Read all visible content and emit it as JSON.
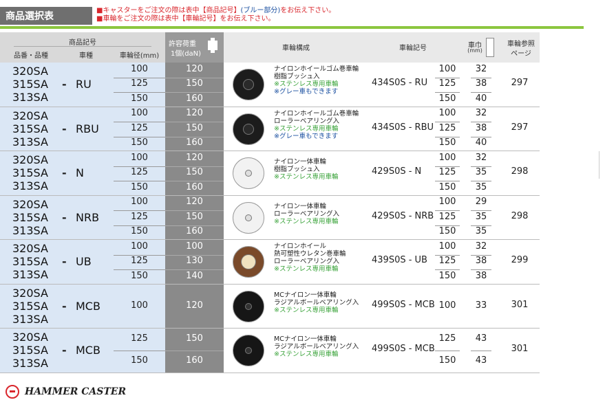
{
  "title": "商品選択表",
  "notes": [
    {
      "pre": "■キャスターをご注文の際は表中【商品記号】",
      "hl": "(ブルー部分)",
      "post": "をお伝え下さい。"
    },
    {
      "pre": "■車輪をご注文の際は表中【車輪記号】をお伝え下さい。",
      "hl": "",
      "post": ""
    }
  ],
  "header": {
    "product_code": "商品記号",
    "part_no": "品番・品種",
    "wheel_type": "車種",
    "wheel_dia": "車輪径(mm)",
    "load_title": "許容荷重",
    "load_unit": "1個(daN)",
    "wheel_config": "車輪構成",
    "wheel_code": "車輪記号",
    "width_title": "車巾",
    "width_unit": "(mm)",
    "ref_page": "車輪参照",
    "ref_page2": "ページ"
  },
  "rows": [
    {
      "models": [
        "320SA",
        "315SA",
        "313SA"
      ],
      "type": "RU",
      "dias": [
        "100",
        "125",
        "150"
      ],
      "loads": [
        "120",
        "150",
        "160"
      ],
      "desc": [
        "ナイロンホイールゴム巻車輪",
        "樹脂ブッシュ入"
      ],
      "green": [
        "※ステンレス専用車輪"
      ],
      "blue": [
        "※グレー車もできます"
      ],
      "wcode": "434S0S - RU",
      "wdias": [
        "100",
        "125",
        "150"
      ],
      "widths": [
        "32",
        "38",
        "40"
      ],
      "page": "297",
      "wheel": "black"
    },
    {
      "models": [
        "320SA",
        "315SA",
        "313SA"
      ],
      "type": "RBU",
      "dias": [
        "100",
        "125",
        "150"
      ],
      "loads": [
        "120",
        "150",
        "160"
      ],
      "desc": [
        "ナイロンホイールゴム巻車輪",
        "ローラーベアリング入"
      ],
      "green": [
        "※ステンレス専用車輪"
      ],
      "blue": [
        "※グレー車もできます"
      ],
      "wcode": "434S0S - RBU",
      "wdias": [
        "100",
        "125",
        "150"
      ],
      "widths": [
        "32",
        "38",
        "40"
      ],
      "page": "297",
      "wheel": "black"
    },
    {
      "models": [
        "320SA",
        "315SA",
        "313SA"
      ],
      "type": "N",
      "dias": [
        "100",
        "125",
        "150"
      ],
      "loads": [
        "120",
        "150",
        "160"
      ],
      "desc": [
        "ナイロン一体車輪",
        "樹脂ブッシュ入"
      ],
      "green": [
        "※ステンレス専用車輪"
      ],
      "blue": [],
      "wcode": "429S0S - N",
      "wdias": [
        "100",
        "125",
        "150"
      ],
      "widths": [
        "32",
        "35",
        "35"
      ],
      "page": "298",
      "wheel": "white"
    },
    {
      "models": [
        "320SA",
        "315SA",
        "313SA"
      ],
      "type": "NRB",
      "dias": [
        "100",
        "125",
        "150"
      ],
      "loads": [
        "120",
        "150",
        "160"
      ],
      "desc": [
        "ナイロン一体車輪",
        "ローラーベアリング入"
      ],
      "green": [
        "※ステンレス専用車輪"
      ],
      "blue": [],
      "wcode": "429S0S - NRB",
      "wdias": [
        "100",
        "125",
        "150"
      ],
      "widths": [
        "29",
        "35",
        "35"
      ],
      "page": "298",
      "wheel": "white"
    },
    {
      "models": [
        "320SA",
        "315SA",
        "313SA"
      ],
      "type": "UB",
      "dias": [
        "100",
        "125",
        "150"
      ],
      "loads": [
        "100",
        "130",
        "140"
      ],
      "desc": [
        "ナイロンホイール",
        "熱可塑性ウレタン巻車輪",
        "ローラーベアリング入"
      ],
      "green": [
        "※ステンレス専用車輪"
      ],
      "blue": [],
      "wcode": "439S0S - UB",
      "wdias": [
        "100",
        "125",
        "150"
      ],
      "widths": [
        "32",
        "38",
        "38"
      ],
      "page": "299",
      "wheel": "brown"
    },
    {
      "models": [
        "320SA",
        "315SA",
        "313SA"
      ],
      "type": "MCB",
      "dias": [
        "100"
      ],
      "loads": [
        "120"
      ],
      "desc": [
        "MCナイロン一体車輪",
        "ラジアルボールベアリング入"
      ],
      "green": [
        "※ステンレス専用車輪"
      ],
      "blue": [],
      "wcode": "499S0S - MCB",
      "wdias": [
        "100"
      ],
      "widths": [
        "33"
      ],
      "page": "301",
      "wheel": "dark"
    },
    {
      "models": [
        "320SA",
        "315SA",
        "313SA"
      ],
      "type": "MCB",
      "dias": [
        "125",
        "150"
      ],
      "loads": [
        "150",
        "160"
      ],
      "desc": [
        "MCナイロン一体車輪",
        "ラジアルボールベアリング入"
      ],
      "green": [
        "※ステンレス専用車輪"
      ],
      "blue": [],
      "wcode": "499S0S - MCB",
      "wdias": [
        "125",
        "150"
      ],
      "widths": [
        "43",
        "43"
      ],
      "page": "301",
      "wheel": "dark"
    }
  ],
  "logo": "HAMMER CASTER",
  "colors": {
    "blue_col": "#dbe7f5",
    "gray_col": "#8a8a8a",
    "green_note": "#3aa33a",
    "red_note": "#d9262c",
    "accent_line": "#8cc63f"
  }
}
